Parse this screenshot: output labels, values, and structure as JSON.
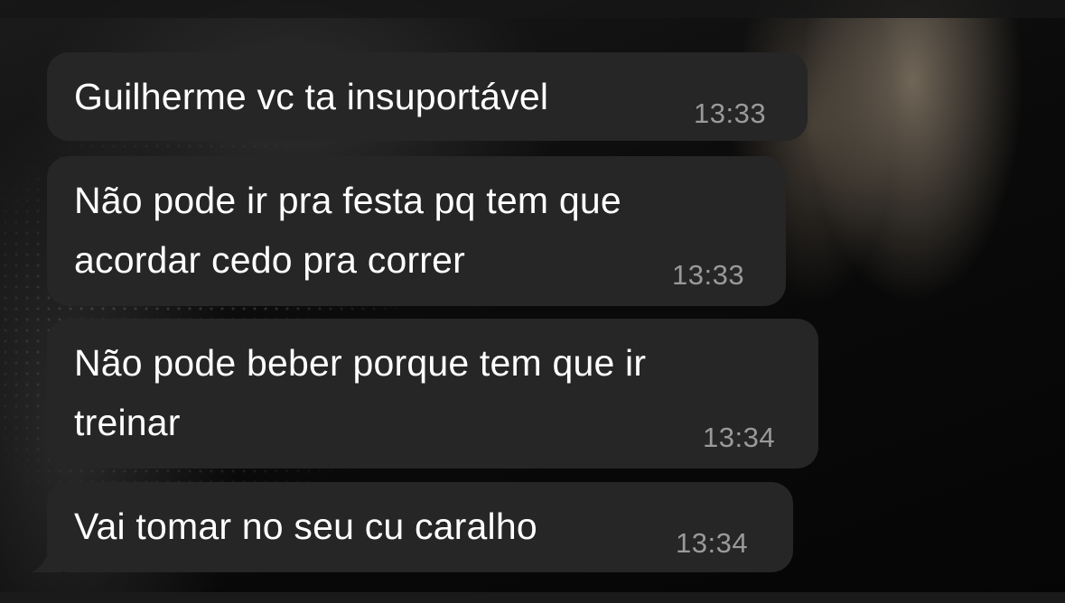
{
  "messages": [
    {
      "text": "Guilherme vc ta insuportável",
      "time": "13:33"
    },
    {
      "text": "Não pode ir pra festa pq tem que\nacordar cedo pra correr",
      "time": "13:33"
    },
    {
      "text": "Não pode beber porque tem que ir\ntreinar",
      "time": "13:34"
    },
    {
      "text": "Vai tomar no seu cu caralho",
      "time": "13:34"
    }
  ],
  "colors": {
    "bubble_background": "#262626",
    "message_text": "#ffffff",
    "timestamp_text": "#9a9a9a",
    "wallpaper": "#0a0a0a"
  }
}
